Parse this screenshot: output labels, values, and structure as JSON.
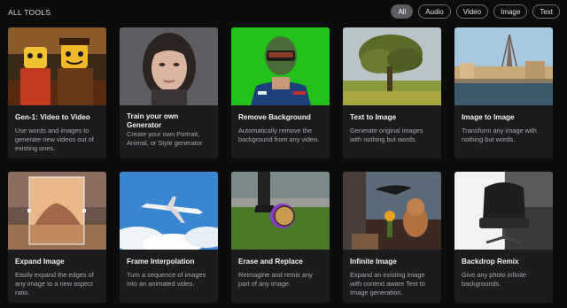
{
  "header": {
    "title": "ALL TOOLS",
    "filters": [
      "All",
      "Audio",
      "Video",
      "Image",
      "Text"
    ],
    "active_filter": "All"
  },
  "cards": [
    {
      "title": "Gen-1: Video to Video",
      "desc": "Use words and images to generate new videos out of existing ones.",
      "thumb": "lego-figures"
    },
    {
      "title": "Train your own Generator",
      "desc": "Create your own Portrait, Animal, or Style generator",
      "thumb": "portrait"
    },
    {
      "title": "Remove Background",
      "desc": "Automatically remove the background from any video.",
      "thumb": "green-screen-astronaut"
    },
    {
      "title": "Text to Image",
      "desc": "Generate original images with nothing but words.",
      "thumb": "tree-landscape"
    },
    {
      "title": "Image to Image",
      "desc": "Transform any image with nothing but words.",
      "thumb": "paris-cityscape"
    },
    {
      "title": "Expand Image",
      "desc": "Easily expand the edges of any image to a new aspect ratio.",
      "thumb": "desert-mountain"
    },
    {
      "title": "Frame Interpolation",
      "desc": "Turn a sequence of images into an animated video.",
      "thumb": "airplane-sky"
    },
    {
      "title": "Erase and Replace",
      "desc": "Reimagine and remix any part of any image.",
      "thumb": "soccer-ball"
    },
    {
      "title": "Infinite Image",
      "desc": "Expand an existing image with context aware Text to Image generation.",
      "thumb": "surreal-cat"
    },
    {
      "title": "Backdrop Remix",
      "desc": "Give any photo infinite backgrounds.",
      "thumb": "lounge-chair"
    }
  ],
  "colors": {
    "background": "#0c0c0d",
    "card": "#1c1c1e",
    "chip_active": "#5b5d63",
    "chip_border": "#6b6b70"
  }
}
